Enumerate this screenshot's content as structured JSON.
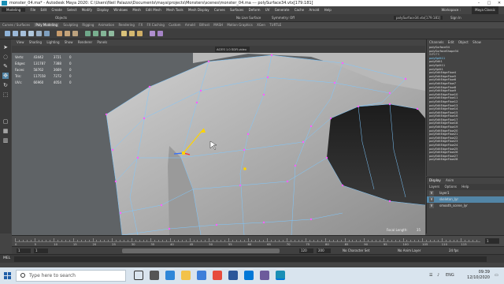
{
  "window": {
    "title": "monster_04.ma* - Autodesk Maya 2020: C:\\Users\\Neil Palazzo\\Documents\\maya\\projects\\Monsters\\scenes\\monster_04.ma --- polySurface34.vtx[179:181]"
  },
  "menubar": {
    "items": [
      "Modeling",
      "File",
      "Edit",
      "Create",
      "Select",
      "Modify",
      "Display",
      "Windows",
      "Mesh",
      "Edit Mesh",
      "Mesh Tools",
      "Mesh Display",
      "Curves",
      "Surfaces",
      "Deform",
      "UV",
      "Generate",
      "Cache",
      "Arnold",
      "Help"
    ],
    "workspace_label": "Workspace :",
    "workspace_value": "Maya Classic"
  },
  "status": {
    "objects_label": "Objects",
    "no_live_surface": "No Live Surface",
    "symmetry": "Symmetry: Off",
    "selected_node": "polySurface34.vtx[179:181]",
    "sign_in": "Sign In"
  },
  "shelf": {
    "tabs": [
      "Curves / Surfaces",
      "Poly Modeling",
      "Sculpting",
      "Rigging",
      "Animation",
      "Rendering",
      "FX",
      "FX Caching",
      "Custom",
      "Arnold",
      "Bifrost",
      "MASH",
      "Motion Graphics",
      "XGen",
      "TURTLE"
    ],
    "active_tab": "Poly Modeling"
  },
  "viewport": {
    "menu": [
      "View",
      "Shading",
      "Lighting",
      "Show",
      "Renderer",
      "Panels"
    ],
    "colorspace": "ACES 1.0 SDR-video",
    "hud": {
      "rows": [
        {
          "label": "Verts:",
          "v1": "43442",
          "v2": "3721",
          "v3": "0"
        },
        {
          "label": "Edges:",
          "v1": "131787",
          "v2": "7388",
          "v3": "0"
        },
        {
          "label": "Faces:",
          "v1": "58762",
          "v2": "3669",
          "v3": "0"
        },
        {
          "label": "Tris:",
          "v1": "117558",
          "v2": "7272",
          "v3": "0"
        },
        {
          "label": "UVs:",
          "v1": "66960",
          "v2": "4054",
          "v3": "0"
        }
      ]
    },
    "focal_length_label": "Focal Length:",
    "focal_length_value": "35"
  },
  "channel_box": {
    "menu": [
      "Channels",
      "Edit",
      "Object",
      "Show"
    ],
    "header_lines": [
      "polySurface34",
      "polySurfaceShape34",
      "INPUTS"
    ],
    "nodes": [
      "polySplit11",
      "polyEdit1",
      "polySplit11",
      "polySplit1",
      "polyEditEdgeFlow4",
      "polyEditEdgeFlow5",
      "polyEditEdgeFlow6",
      "polyEditEdgeFlow7",
      "polyEditEdgeFlow8",
      "polyEditEdgeFlow9",
      "polyEditEdgeFlow10",
      "polyEditEdgeFlow11",
      "polyEditEdgeFlow12",
      "polyEditEdgeFlow13",
      "polyEditEdgeFlow14",
      "polyEditEdgeFlow15",
      "polyEditEdgeFlow16",
      "polyEditEdgeFlow17",
      "polyEditEdgeFlow18",
      "polyEditEdgeFlow19",
      "polyEditEdgeFlow20",
      "polyEditEdgeFlow21",
      "polyEditEdgeFlow22",
      "polyEditEdgeFlow23",
      "polyEditEdgeFlow24",
      "polyEditEdgeFlow25",
      "polyEditEdgeFlow26",
      "polyEditEdgeFlow27",
      "polyEditEdgeFlow28"
    ]
  },
  "layers": {
    "tabs": [
      "Display",
      "Anim"
    ],
    "sub": [
      "Layers",
      "Options",
      "Help"
    ],
    "items": [
      {
        "name": "layer1",
        "selected": false
      },
      {
        "name": "skeleton_lyr",
        "selected": true
      },
      {
        "name": "smooth_scene_lyr",
        "selected": false
      }
    ]
  },
  "timeslider": {
    "ticks": [
      "0",
      "5",
      "10",
      "15",
      "20",
      "25",
      "30",
      "35",
      "40",
      "45",
      "50",
      "55",
      "60",
      "65",
      "70",
      "75",
      "80",
      "85",
      "90",
      "95",
      "100",
      "105",
      "110",
      "115"
    ],
    "current_frame": "1"
  },
  "range": {
    "start": "1",
    "inner_start": "1",
    "inner_end": "120",
    "end": "200",
    "char_set": "No Character Set",
    "anim_layer": "No Anim Layer",
    "fps": "24 fps"
  },
  "cmdline": {
    "label": "MEL"
  },
  "taskbar": {
    "search_placeholder": "Type here to search",
    "lang": "ENG",
    "time": "09:39",
    "date": "12/10/2020"
  },
  "colors": {
    "wire": "#7ec8ff",
    "vertex": "#ff5cff",
    "selected_vertex": "#ffd400",
    "accent": "#5285a6"
  }
}
